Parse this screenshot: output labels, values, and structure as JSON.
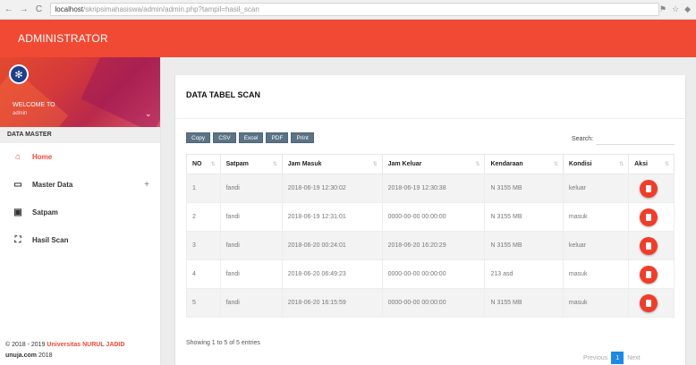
{
  "browser": {
    "back": "←",
    "forward": "→",
    "reload": "C",
    "url_host": "localhost",
    "url_path": "/skripsimahasiswa/admin/admin.php?tampil=hasil_scan"
  },
  "header": {
    "title": "ADMINISTRATOR"
  },
  "sidebar": {
    "welcome": "WELCOME TO",
    "username": "admin",
    "section": "DATA MASTER",
    "items": [
      {
        "label": "Home",
        "icon": "home-icon",
        "glyph": "⌂"
      },
      {
        "label": "Master Data",
        "icon": "laptop-icon",
        "glyph": "▭",
        "expand": "+"
      },
      {
        "label": "Satpam",
        "icon": "id-card-icon",
        "glyph": "▣"
      },
      {
        "label": "Hasil Scan",
        "icon": "scan-icon",
        "glyph": "⛶"
      }
    ],
    "footer_copy": "© 2018 - 2019 ",
    "footer_uni": "Universitas NURUL JADID",
    "footer_domain": "unuja.com",
    "footer_year": " 2018"
  },
  "main": {
    "title": "DATA TABEL SCAN",
    "buttons": [
      "Copy",
      "CSV",
      "Excel",
      "PDF",
      "Print"
    ],
    "search_label": "Search:",
    "columns": [
      "NO",
      "Satpam",
      "Jam Masuk",
      "Jam Keluar",
      "Kendaraan",
      "Kondisi",
      "Aksi"
    ],
    "rows": [
      [
        "1",
        "fandi",
        "2018-06-19 12:30:02",
        "2018-06-19 12:30:38",
        "N 3155 MB",
        "keluar"
      ],
      [
        "2",
        "fandi",
        "2018-06-19 12:31:01",
        "0000-00-00 00:00:00",
        "N 3155 MB",
        "masuk"
      ],
      [
        "3",
        "fandi",
        "2018-06-20 00:24:01",
        "2018-06-20 16:20:29",
        "N 3155 MB",
        "keluar"
      ],
      [
        "4",
        "fandi",
        "2018-06-20 06:49:23",
        "0000-00-00 00:00:00",
        "213 asd",
        "masuk"
      ],
      [
        "5",
        "fandi",
        "2018-06-20 16:15:59",
        "0000-00-00 00:00:00",
        "N 3155 MB",
        "masuk"
      ]
    ],
    "info": "Showing 1 to 5 of 5 entries",
    "pagination": {
      "previous": "Previous",
      "current": "1",
      "next": "Next"
    }
  },
  "colors": {
    "accent": "#f04a34",
    "button": "#5b7384",
    "page_active": "#1e88e5"
  }
}
